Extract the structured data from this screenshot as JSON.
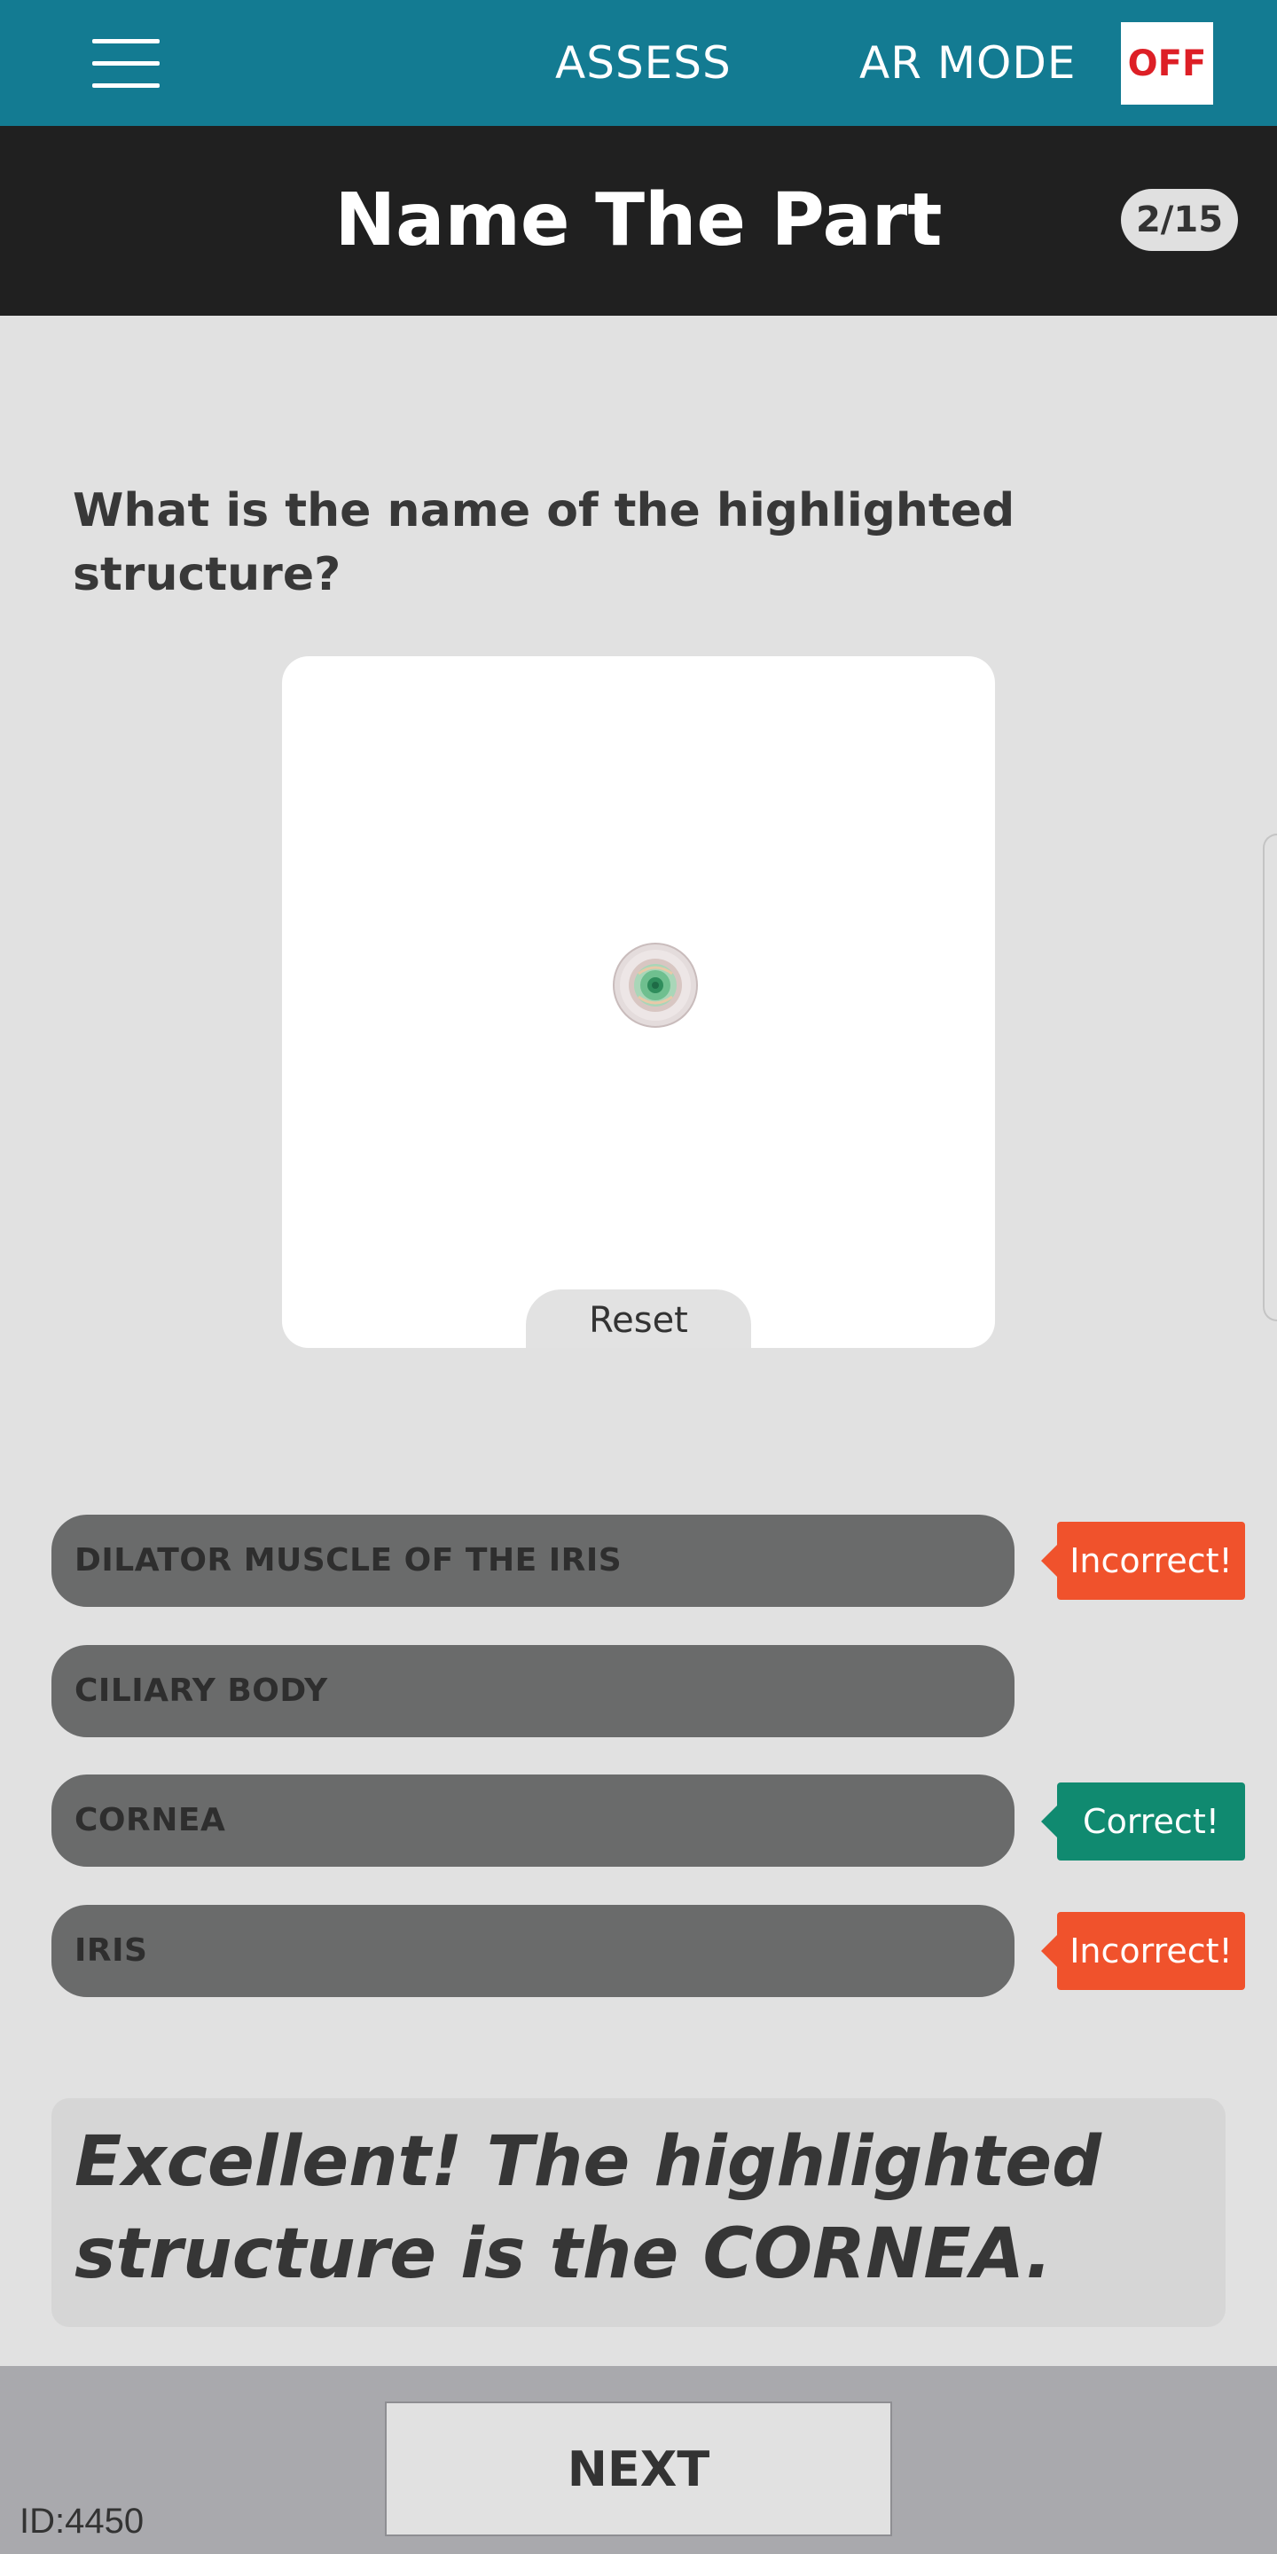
{
  "topbar": {
    "menu_icon": "hamburger-menu-icon",
    "assess_label": "ASSESS",
    "ar_mode_label": "AR MODE",
    "ar_toggle_label": "OFF",
    "color": "#137b92",
    "toggle_text_color": "#dd1f26"
  },
  "header": {
    "title": "Name The Part",
    "progress": "2/15"
  },
  "question": {
    "text": "What is the name of the highlighted structure?"
  },
  "viewer": {
    "model_icon": "eye-model-icon",
    "reset_label": "Reset"
  },
  "answers": [
    {
      "label": "DILATOR MUSCLE OF THE IRIS",
      "feedback": "Incorrect!",
      "status": "incorrect"
    },
    {
      "label": "CILIARY BODY",
      "feedback": "",
      "status": "none"
    },
    {
      "label": "CORNEA",
      "feedback": "Correct!",
      "status": "correct"
    },
    {
      "label": "IRIS",
      "feedback": "Incorrect!",
      "status": "incorrect"
    }
  ],
  "colors": {
    "incorrect": "#f0522c",
    "correct": "#108a70",
    "answer_background": "#6a6b6b"
  },
  "result": {
    "message": "Excellent! The highlighted structure is the CORNEA."
  },
  "footer": {
    "next_label": "NEXT",
    "id_text": "ID:4450"
  }
}
